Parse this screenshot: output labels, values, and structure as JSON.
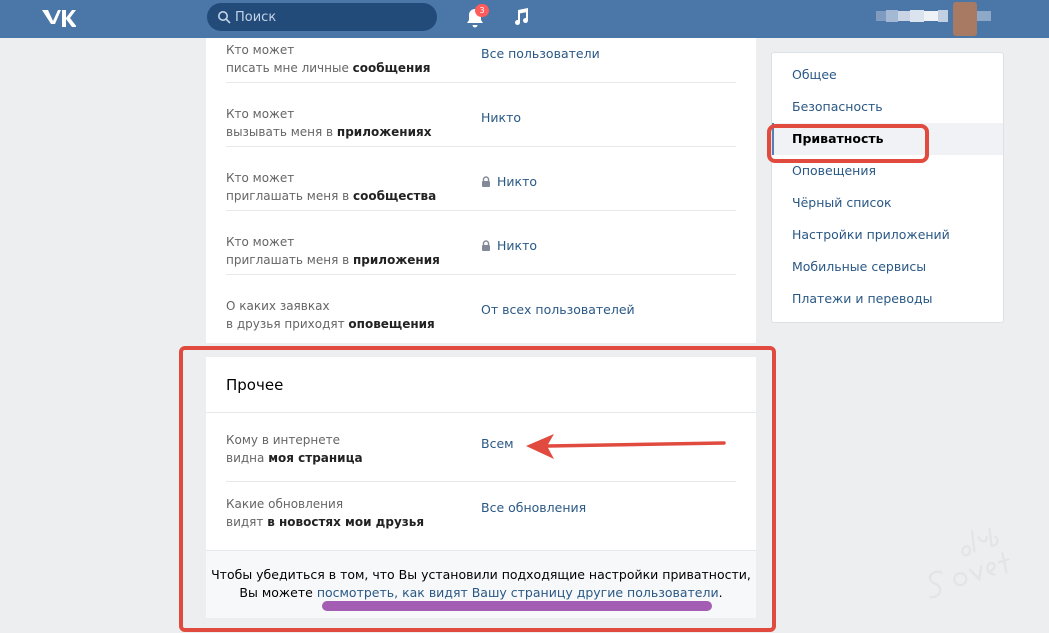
{
  "header": {
    "search_placeholder": "Поиск",
    "notifications_count": "3"
  },
  "privacy_rows": [
    {
      "label_prefix": "Кто может",
      "label_line2": "писать мне личные ",
      "label_bold": "сообщения",
      "value": "Все пользователи",
      "locked": false
    },
    {
      "label_prefix": "Кто может",
      "label_line2": "вызывать меня в ",
      "label_bold": "приложениях",
      "value": "Никто",
      "locked": false
    },
    {
      "label_prefix": "Кто может",
      "label_line2": "приглашать меня в ",
      "label_bold": "сообщества",
      "value": "Никто",
      "locked": true
    },
    {
      "label_prefix": "Кто может",
      "label_line2": "приглашать меня в ",
      "label_bold": "приложения",
      "value": "Никто",
      "locked": true
    },
    {
      "label_prefix": "О каких заявках",
      "label_line2": "в друзья приходят ",
      "label_bold": "оповещения",
      "value": "От всех пользователей",
      "locked": false
    }
  ],
  "other_section": {
    "title": "Прочее",
    "rows": [
      {
        "label_prefix": "Кому в интернете",
        "label_line2": "видна ",
        "label_bold": "моя страница",
        "value": "Всем"
      },
      {
        "label_prefix": "Какие обновления",
        "label_line2": "видят ",
        "label_bold": "в новостях мои друзья",
        "value": "Все обновления"
      }
    ],
    "footer_text_line1": "Чтобы убедиться в том, что Вы установили подходящие настройки приватности,",
    "footer_text_prefix": "Вы можете ",
    "footer_link": "посмотреть, как видят Вашу страницу другие пользователи",
    "footer_text_suffix": "."
  },
  "settings_menu": {
    "items": [
      "Общее",
      "Безопасность",
      "Приватность",
      "Оповещения",
      "Чёрный список",
      "Настройки приложений",
      "Мобильные сервисы",
      "Платежи и переводы"
    ],
    "active": "Приватность"
  },
  "watermark": {
    "line1": "club",
    "line2": "Sovet"
  },
  "colors": {
    "header_bg": "#4a76a8",
    "link": "#2a5885",
    "highlight_red": "#e14a3f",
    "highlight_purple": "#a35eb3"
  }
}
